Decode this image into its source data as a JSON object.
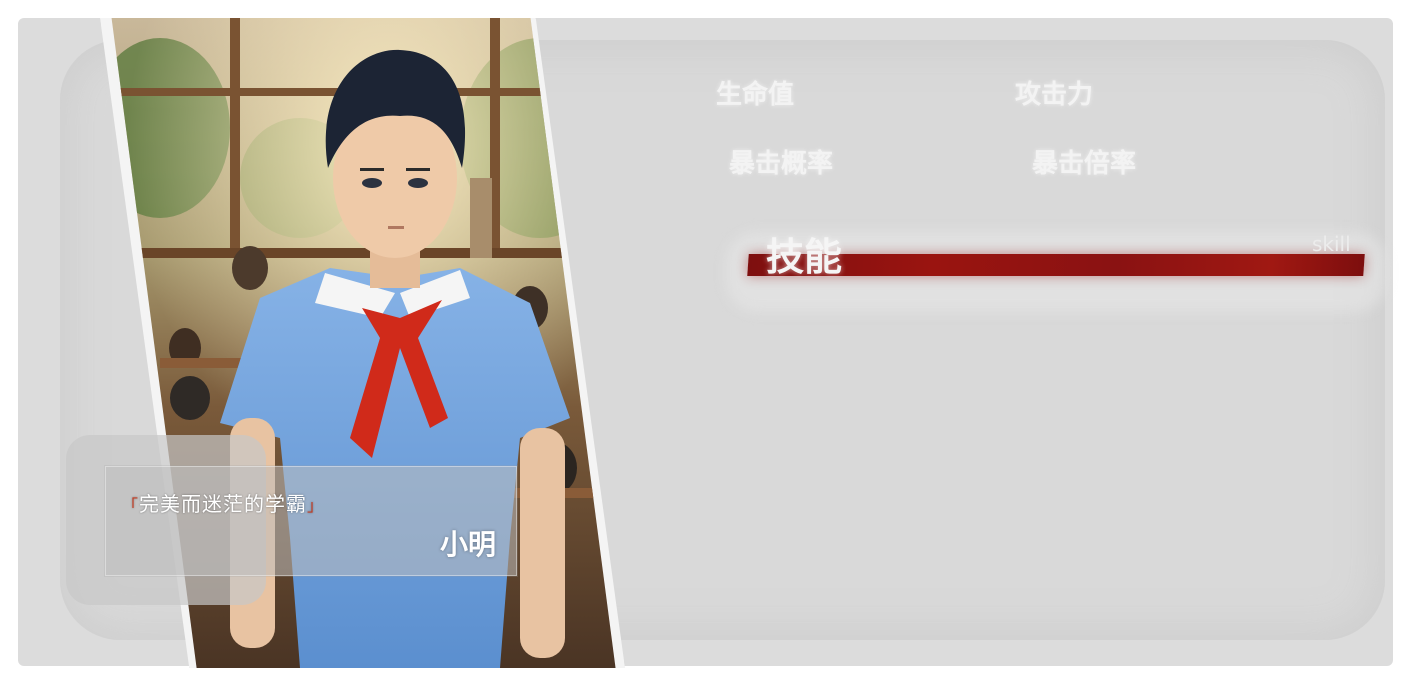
{
  "character": {
    "epithet": "完美而迷茫的学霸",
    "epithet_open": "「",
    "epithet_close": "」",
    "name": "小明"
  },
  "stats": {
    "hp_label": "生命值",
    "atk_label": "攻击力",
    "crit_rate_label": "暴击概率",
    "crit_dmg_label": "暴击倍率"
  },
  "skill": {
    "title": "技能",
    "subtitle": "skill"
  },
  "colors": {
    "panel": "#dcdcdc",
    "skill_bar": "#8a1212",
    "scarf": "#d02a1a",
    "uniform": "#6c9ed8"
  }
}
